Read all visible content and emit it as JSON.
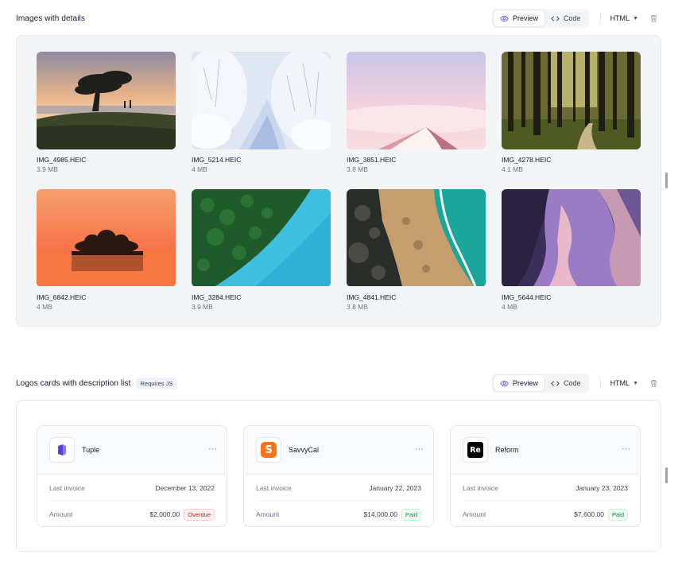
{
  "sections": [
    {
      "title": "Images with details",
      "controls": {
        "preview_label": "Preview",
        "code_label": "Code",
        "language": "HTML"
      },
      "images": [
        {
          "name": "IMG_4985.HEIC",
          "size": "3.9 MB"
        },
        {
          "name": "IMG_5214.HEIC",
          "size": "4 MB"
        },
        {
          "name": "IMG_3851.HEIC",
          "size": "3.8 MB"
        },
        {
          "name": "IMG_4278.HEIC",
          "size": "4.1 MB"
        },
        {
          "name": "IMG_6842.HEIC",
          "size": "4 MB"
        },
        {
          "name": "IMG_3284.HEIC",
          "size": "3.9 MB"
        },
        {
          "name": "IMG_4841.HEIC",
          "size": "3.8 MB"
        },
        {
          "name": "IMG_5644.HEIC",
          "size": "4 MB"
        }
      ]
    },
    {
      "title": "Logos cards with description list",
      "badge": "Requires JS",
      "controls": {
        "preview_label": "Preview",
        "code_label": "Code",
        "language": "HTML"
      },
      "clients": [
        {
          "name": "Tuple",
          "logo_icon": "tuple-logo-icon",
          "logo_color": "#5b3fd6",
          "last_invoice_label": "Last invoice",
          "last_invoice": "December 13, 2022",
          "amount_label": "Amount",
          "amount": "$2,000.00",
          "status": "Overdue",
          "status_kind": "overdue"
        },
        {
          "name": "SavvyCal",
          "logo_icon": "savvycal-logo-icon",
          "logo_color": "#f97316",
          "logo_letter": "S",
          "last_invoice_label": "Last invoice",
          "last_invoice": "January 22, 2023",
          "amount_label": "Amount",
          "amount": "$14,000.00",
          "status": "Paid",
          "status_kind": "paid"
        },
        {
          "name": "Reform",
          "logo_icon": "reform-logo-icon",
          "logo_color": "#000000",
          "logo_letter": "Re",
          "last_invoice_label": "Last invoice",
          "last_invoice": "January 23, 2023",
          "amount_label": "Amount",
          "amount": "$7,600.00",
          "status": "Paid",
          "status_kind": "paid"
        }
      ]
    }
  ],
  "icons": {
    "preview": "eye-icon",
    "code": "code-icon",
    "dropdown": "chevron-down-icon",
    "delete": "trash-icon",
    "more": "ellipsis-icon"
  }
}
